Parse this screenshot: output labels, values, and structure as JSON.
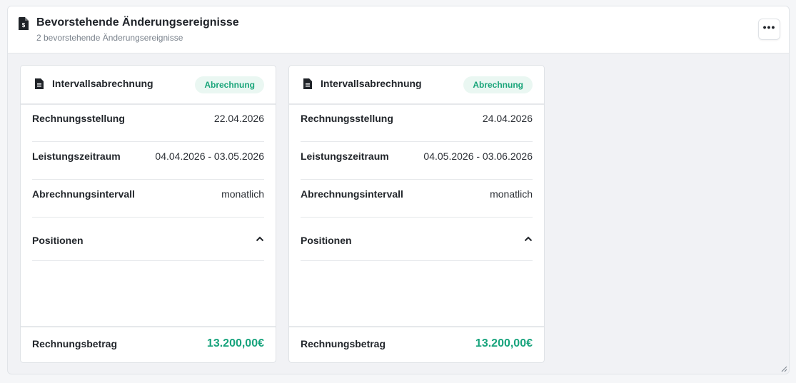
{
  "header": {
    "title": "Bevorstehende Änderungsereignisse",
    "subtitle": "2 bevorstehende Änderungsereignisse",
    "menu_label": "•••"
  },
  "cards": [
    {
      "title": "Intervallsabrechnung",
      "badge": "Abrechnung",
      "rows": [
        {
          "label": "Rechnungsstellung",
          "value": "22.04.2026"
        },
        {
          "label": "Leistungszeitraum",
          "value": "04.04.2026 - 03.05.2026"
        },
        {
          "label": "Abrechnungsintervall",
          "value": "monatlich"
        }
      ],
      "positions_label": "Positionen",
      "total_label": "Rechnungsbetrag",
      "total_value": "13.200,00€"
    },
    {
      "title": "Intervallsabrechnung",
      "badge": "Abrechnung",
      "rows": [
        {
          "label": "Rechnungsstellung",
          "value": "24.04.2026"
        },
        {
          "label": "Leistungszeitraum",
          "value": "04.05.2026 - 03.06.2026"
        },
        {
          "label": "Abrechnungsintervall",
          "value": "monatlich"
        }
      ],
      "positions_label": "Positionen",
      "total_label": "Rechnungsbetrag",
      "total_value": "13.200,00€"
    }
  ],
  "colors": {
    "accent": "#17a37c",
    "badge_bg": "#eaf7f2"
  },
  "icons": {
    "header": "invoice-icon",
    "card": "document-icon",
    "positions": "chevron-up-icon"
  }
}
